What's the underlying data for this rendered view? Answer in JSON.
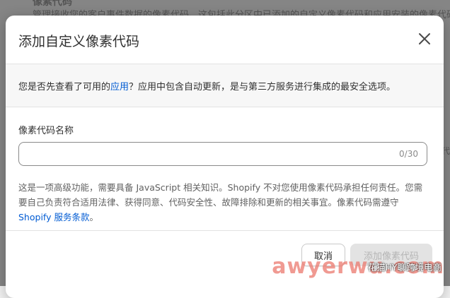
{
  "background": {
    "heading": "像素代码",
    "description": "管理接收您的客户事件数据的像素代码。这包括此分区中已添加的自定义像素代码和应用安装的像素代码",
    "side_fragment": "代"
  },
  "modal": {
    "title": "添加自定义像素代码",
    "close_label": "关闭",
    "notice": {
      "prefix": "您是否先查看了可用的",
      "link": "应用",
      "suffix": "？应用中包含自动更新，是与第三方服务进行集成的最安全选项。"
    },
    "field": {
      "label": "像素代码名称",
      "value": "",
      "placeholder": "",
      "counter": "0/30"
    },
    "help": {
      "text": "这是一项高级功能，需要具备 JavaScript 相关知识。Shopify 不对您使用像素代码承担任何责任。您需要自己负责符合适用法律、获得同意、代码安全性、故障排除和更新的相关事宜。像素代码需遵守 ",
      "link": "Shopify 服务条款",
      "suffix": "。"
    },
    "buttons": {
      "cancel": "取消",
      "primary": "添加像素代码"
    }
  },
  "watermark": {
    "text": "awyerwu.com",
    "sub": "花猫HY聊跨境电商"
  },
  "colors": {
    "link": "#005bd3",
    "overlay": "rgba(0,0,0,0.45)",
    "primary_disabled_bg": "#e3e3e3"
  }
}
